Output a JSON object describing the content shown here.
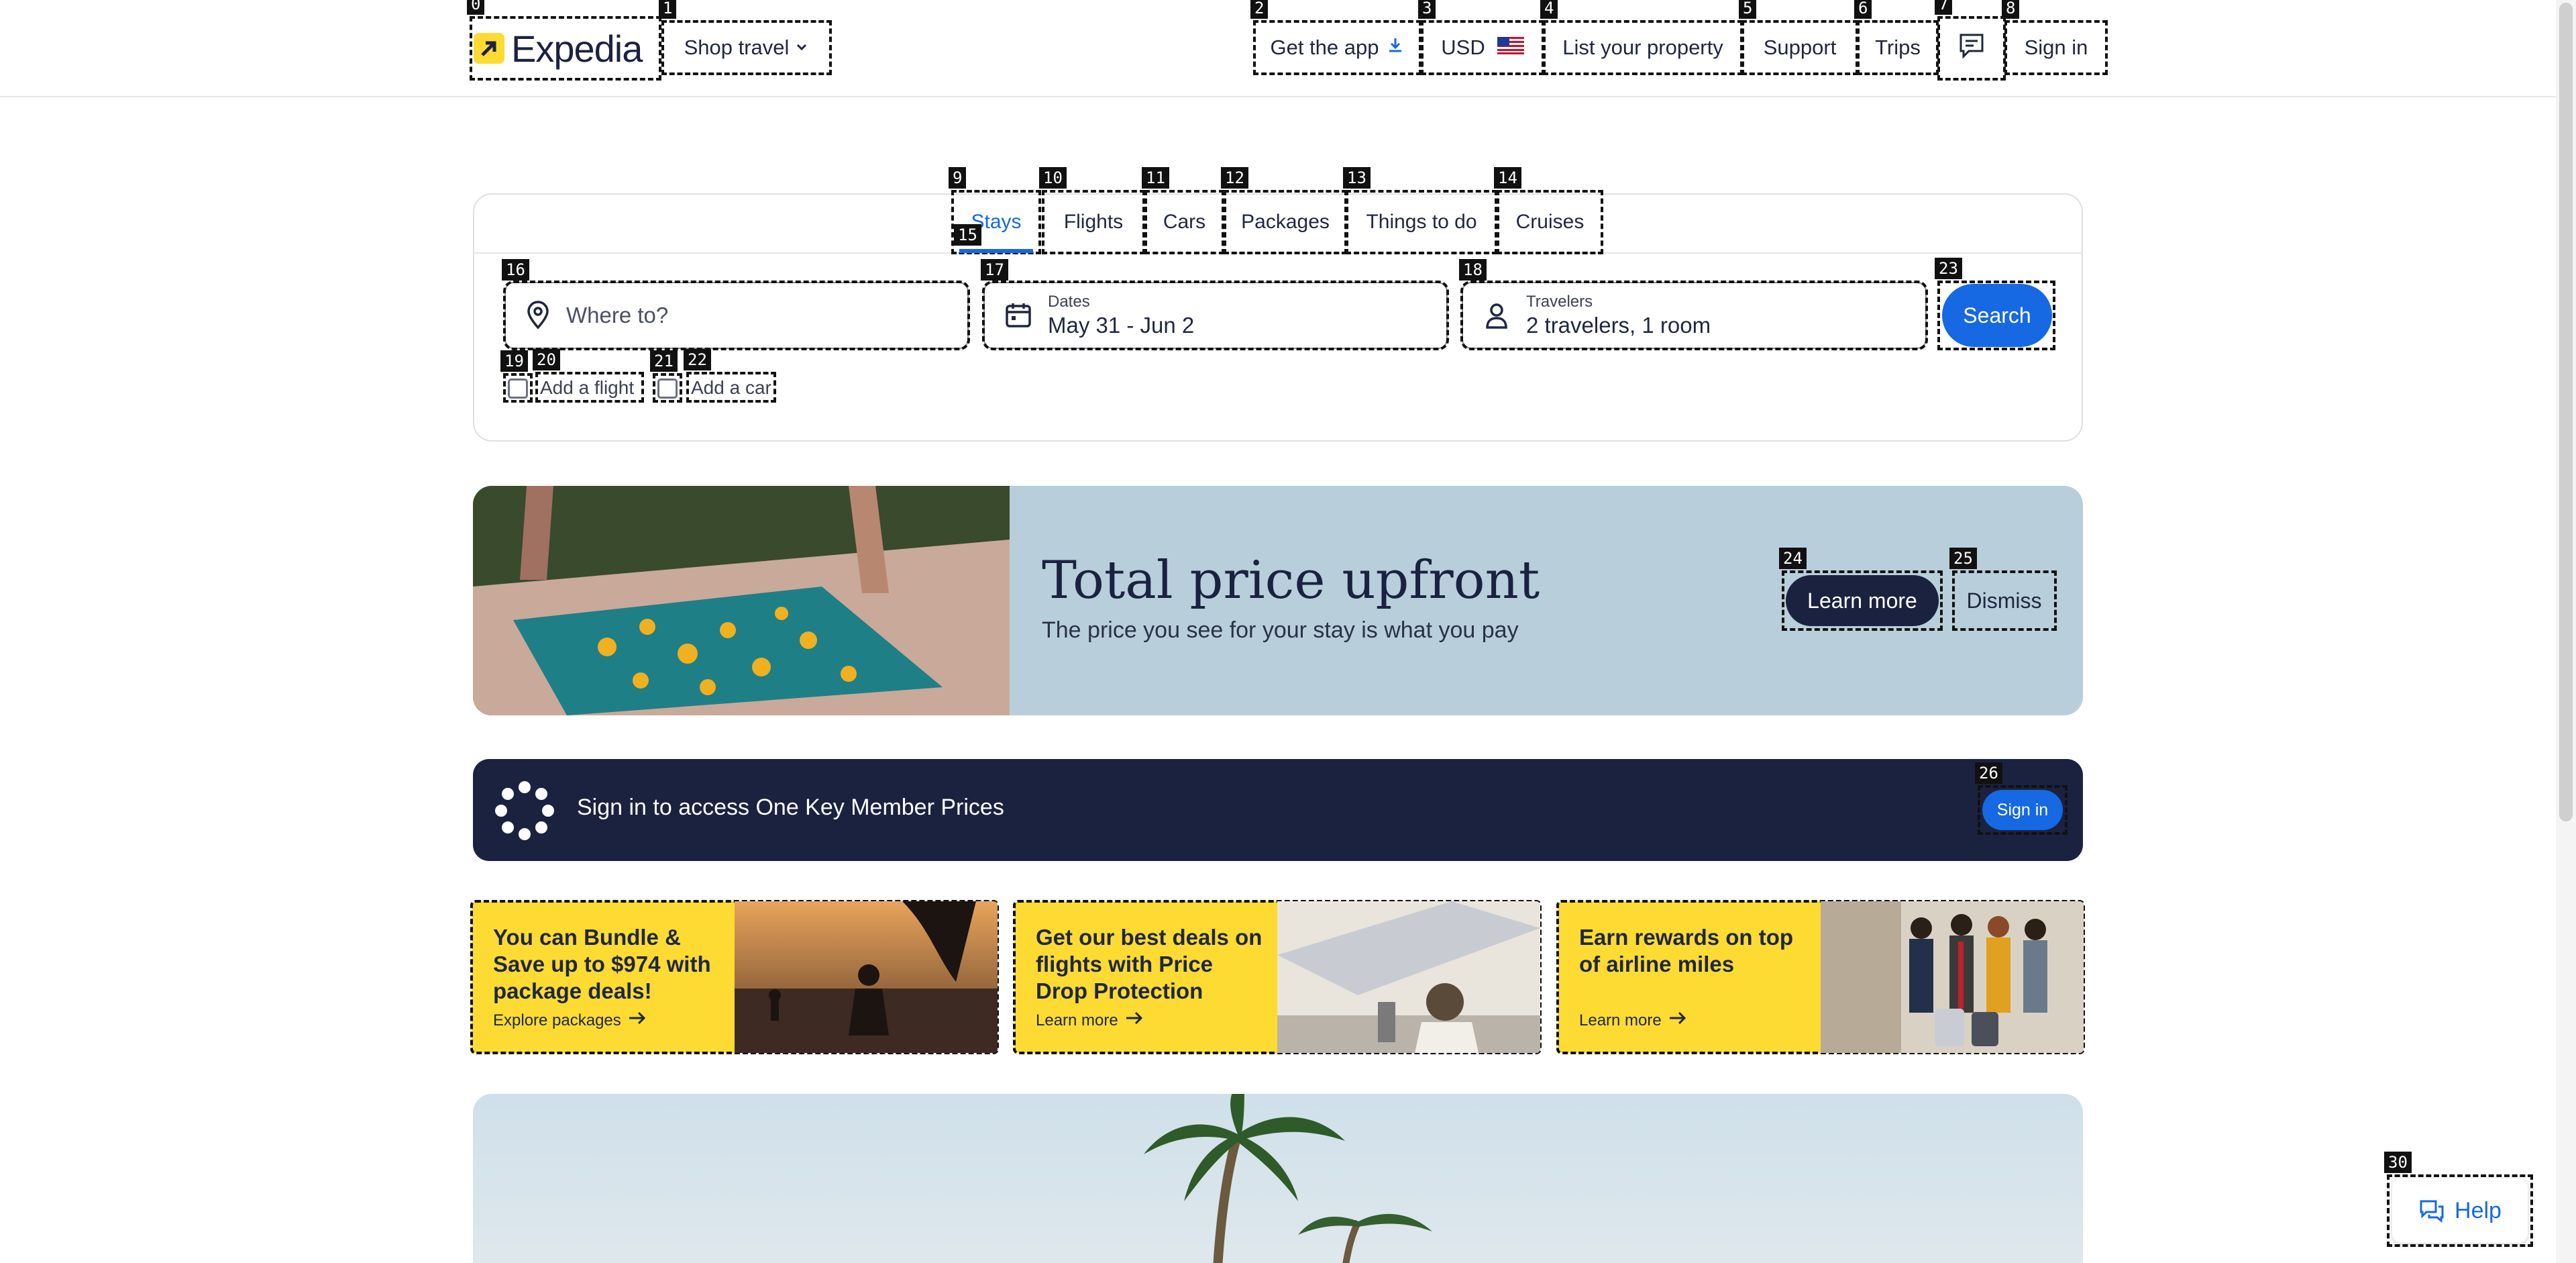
{
  "header": {
    "logo_text": "Expedia",
    "shop_travel": "Shop travel",
    "get_app": "Get the app",
    "currency": "USD",
    "list_property": "List your property",
    "support": "Support",
    "trips": "Trips",
    "sign_in": "Sign in"
  },
  "tabs": [
    "Stays",
    "Flights",
    "Cars",
    "Packages",
    "Things to do",
    "Cruises"
  ],
  "search": {
    "destination_placeholder": "Where to?",
    "dates_label": "Dates",
    "dates_value": "May 31 - Jun 2",
    "travelers_label": "Travelers",
    "travelers_value": "2 travelers, 1 room",
    "search_button": "Search",
    "add_flight": "Add a flight",
    "add_car": "Add a car"
  },
  "promo": {
    "title": "Total price upfront",
    "subtitle": "The price you see for your stay is what you pay",
    "learn_more": "Learn more",
    "dismiss": "Dismiss"
  },
  "onekey": {
    "text": "Sign in to access One Key Member Prices",
    "button": "Sign in"
  },
  "cards": [
    {
      "text": "You can Bundle & Save up to $974 with package deals!",
      "link": "Explore packages"
    },
    {
      "text": "Get our best deals on flights with Price Drop Protection",
      "link": "Learn more"
    },
    {
      "text": "Earn rewards on top of airline miles",
      "link": "Learn more"
    }
  ],
  "help": {
    "label": "Help"
  },
  "colors": {
    "brand_yellow": "#fddb32",
    "primary_blue": "#1668e3",
    "navy": "#1b2240",
    "promo_bg": "#b8cedb"
  },
  "icons": [
    "expedia-logo-icon",
    "chevron-down-icon",
    "download-icon",
    "us-flag-icon",
    "chat-icon",
    "location-pin-icon",
    "calendar-icon",
    "person-icon",
    "onekey-icon",
    "arrow-right-icon",
    "help-chat-icon"
  ]
}
